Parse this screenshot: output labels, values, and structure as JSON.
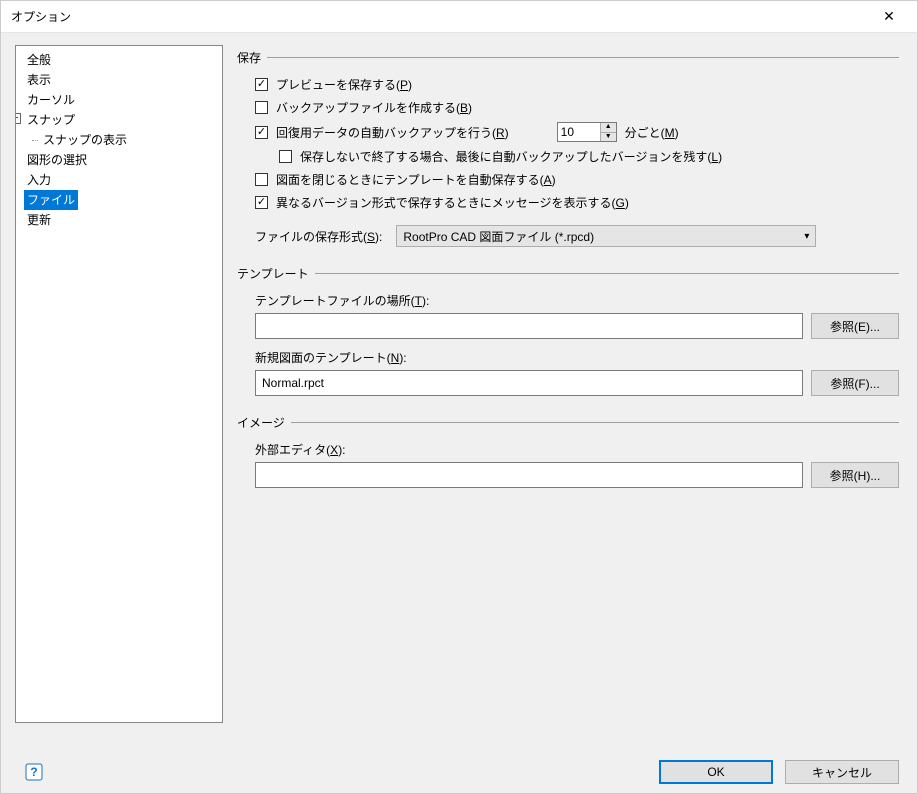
{
  "window": {
    "title": "オプション"
  },
  "tree": {
    "items": [
      "全般",
      "表示",
      "カーソル",
      "スナップ",
      "スナップの表示",
      "図形の選択",
      "入力",
      "ファイル",
      "更新"
    ],
    "selected": "ファイル",
    "expander": "−"
  },
  "save": {
    "group": "保存",
    "preview": {
      "label": "プレビューを保存する(",
      "hotkey": "P",
      "suffix": ")",
      "checked": true
    },
    "backup": {
      "label": "バックアップファイルを作成する(",
      "hotkey": "B",
      "suffix": ")",
      "checked": false
    },
    "autorecover": {
      "label": "回復用データの自動バックアップを行う(",
      "hotkey": "R",
      "suffix": ")",
      "checked": true,
      "interval": "10",
      "unit_prefix": "分ごと(",
      "unit_hotkey": "M",
      "unit_suffix": ")"
    },
    "keeplast": {
      "label": "保存しないで終了する場合、最後に自動バックアップしたバージョンを残す(",
      "hotkey": "L",
      "suffix": ")",
      "checked": false
    },
    "autosave_template": {
      "label": "図面を閉じるときにテンプレートを自動保存する(",
      "hotkey": "A",
      "suffix": ")",
      "checked": false
    },
    "diff_version": {
      "label": "異なるバージョン形式で保存するときにメッセージを表示する(",
      "hotkey": "G",
      "suffix": ")",
      "checked": true
    },
    "format_label_prefix": "ファイルの保存形式(",
    "format_hotkey": "S",
    "format_label_suffix": "):",
    "format_value": "RootPro CAD 図面ファイル (*.rpcd)"
  },
  "template": {
    "group": "テンプレート",
    "location_label_prefix": "テンプレートファイルの場所(",
    "location_hotkey": "T",
    "location_label_suffix": "):",
    "location_value": "",
    "browse1_prefix": "参照(",
    "browse1_hotkey": "E",
    "browse1_suffix": ")...",
    "newdoc_label_prefix": "新規図面のテンプレート(",
    "newdoc_hotkey": "N",
    "newdoc_label_suffix": "):",
    "newdoc_value": "Normal.rpct",
    "browse2_prefix": "参照(",
    "browse2_hotkey": "F",
    "browse2_suffix": ")..."
  },
  "image": {
    "group": "イメージ",
    "editor_label_prefix": "外部エディタ(",
    "editor_hotkey": "X",
    "editor_label_suffix": "):",
    "editor_value": "",
    "browse_prefix": "参照(",
    "browse_hotkey": "H",
    "browse_suffix": ")..."
  },
  "footer": {
    "ok": "OK",
    "cancel": "キャンセル"
  }
}
